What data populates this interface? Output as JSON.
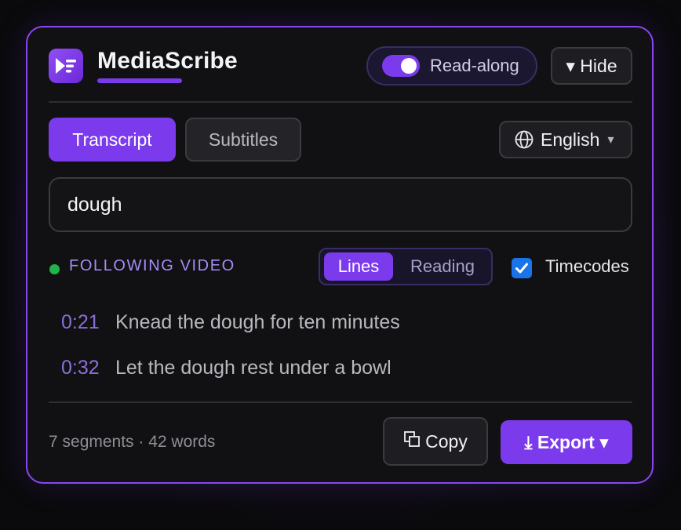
{
  "header": {
    "app_title": "MediaScribe",
    "read_along_label": "Read-along",
    "read_along_on": true,
    "hide_label": "▾ Hide"
  },
  "tabs": [
    {
      "label": "Transcript",
      "active": true
    },
    {
      "label": "Subtitles",
      "active": false
    }
  ],
  "language": {
    "selected": "English",
    "icon": "globe-icon"
  },
  "search": {
    "value": "dough"
  },
  "status": {
    "text": "FOLLOWING VIDEO"
  },
  "view_modes": [
    {
      "label": "Lines",
      "active": true
    },
    {
      "label": "Reading",
      "active": false
    }
  ],
  "timecodes": {
    "label": "Timecodes",
    "checked": true
  },
  "lines": [
    {
      "time": "0:21",
      "text": "Knead the dough for ten minutes"
    },
    {
      "time": "0:32",
      "text": "Let the dough rest under a bowl"
    }
  ],
  "footer": {
    "stats": "7 segments · 42 words",
    "copy_label": "Copy",
    "export_label": "⤓ Export ▾"
  },
  "colors": {
    "accent": "#7c3aed",
    "panel_border": "#8b46f0",
    "status_dot": "#22b34a",
    "timecode": "#8b6fd8"
  }
}
